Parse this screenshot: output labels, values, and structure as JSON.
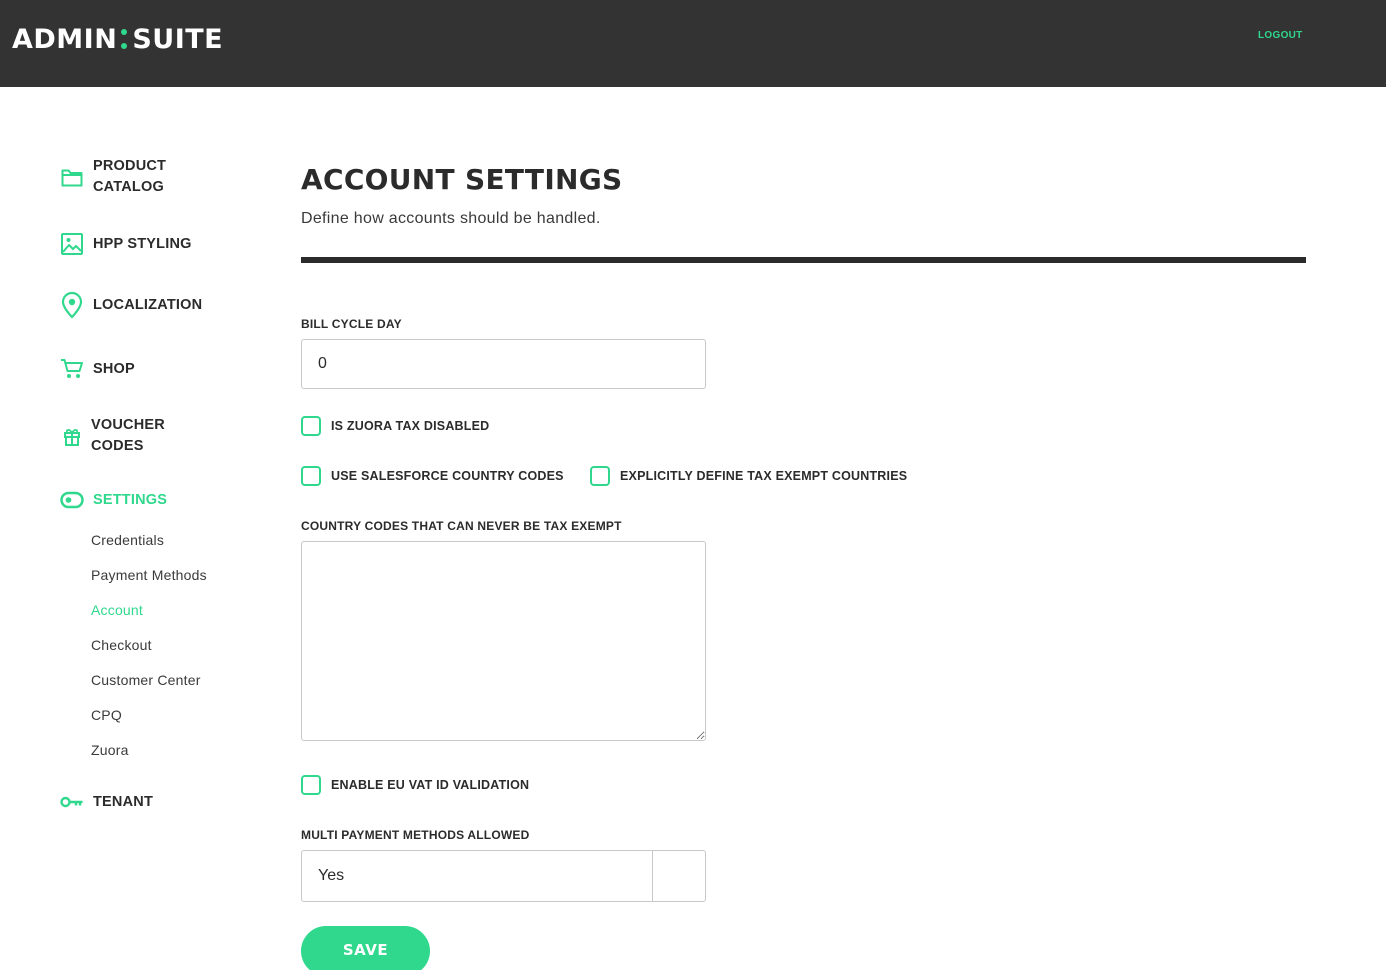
{
  "header": {
    "logo_left": "ADMIN",
    "logo_right": "SUITE",
    "logout_label": "LOGOUT"
  },
  "sidebar": {
    "items": [
      {
        "label": "PRODUCT CATALOG",
        "icon": "folder-icon"
      },
      {
        "label": "HPP STYLING",
        "icon": "image-icon"
      },
      {
        "label": "LOCALIZATION",
        "icon": "location-pin-icon"
      },
      {
        "label": "SHOP",
        "icon": "cart-icon"
      },
      {
        "label": "VOUCHER CODES",
        "icon": "gift-icon"
      },
      {
        "label": "SETTINGS",
        "icon": "toggle-icon",
        "active": true
      },
      {
        "label": "TENANT",
        "icon": "key-icon"
      }
    ],
    "settings_subitems": [
      {
        "label": "Credentials"
      },
      {
        "label": "Payment Methods"
      },
      {
        "label": "Account",
        "active": true
      },
      {
        "label": "Checkout"
      },
      {
        "label": "Customer Center"
      },
      {
        "label": "CPQ"
      },
      {
        "label": "Zuora"
      }
    ]
  },
  "main": {
    "title": "ACCOUNT SETTINGS",
    "subtitle": "Define how accounts should be handled.",
    "bill_cycle_day": {
      "label": "BILL CYCLE DAY",
      "value": "0"
    },
    "zuora_tax_disabled": {
      "label": "IS ZUORA TAX DISABLED",
      "checked": false
    },
    "salesforce_country_codes": {
      "label": "USE SALESFORCE COUNTRY CODES",
      "checked": false
    },
    "explicit_tax_exempt": {
      "label": "EXPLICITLY DEFINE TAX EXEMPT COUNTRIES",
      "checked": false
    },
    "never_tax_exempt": {
      "label": "COUNTRY CODES THAT CAN NEVER BE TAX EXEMPT",
      "value": ""
    },
    "eu_vat_validation": {
      "label": "ENABLE EU VAT ID VALIDATION",
      "checked": false
    },
    "multi_payment_methods": {
      "label": "MULTI PAYMENT METHODS ALLOWED",
      "selected": "Yes"
    },
    "save_label": "SAVE"
  },
  "colors": {
    "accent": "#2fd88c",
    "header_bg": "#333333",
    "text": "#2b2b2b"
  }
}
